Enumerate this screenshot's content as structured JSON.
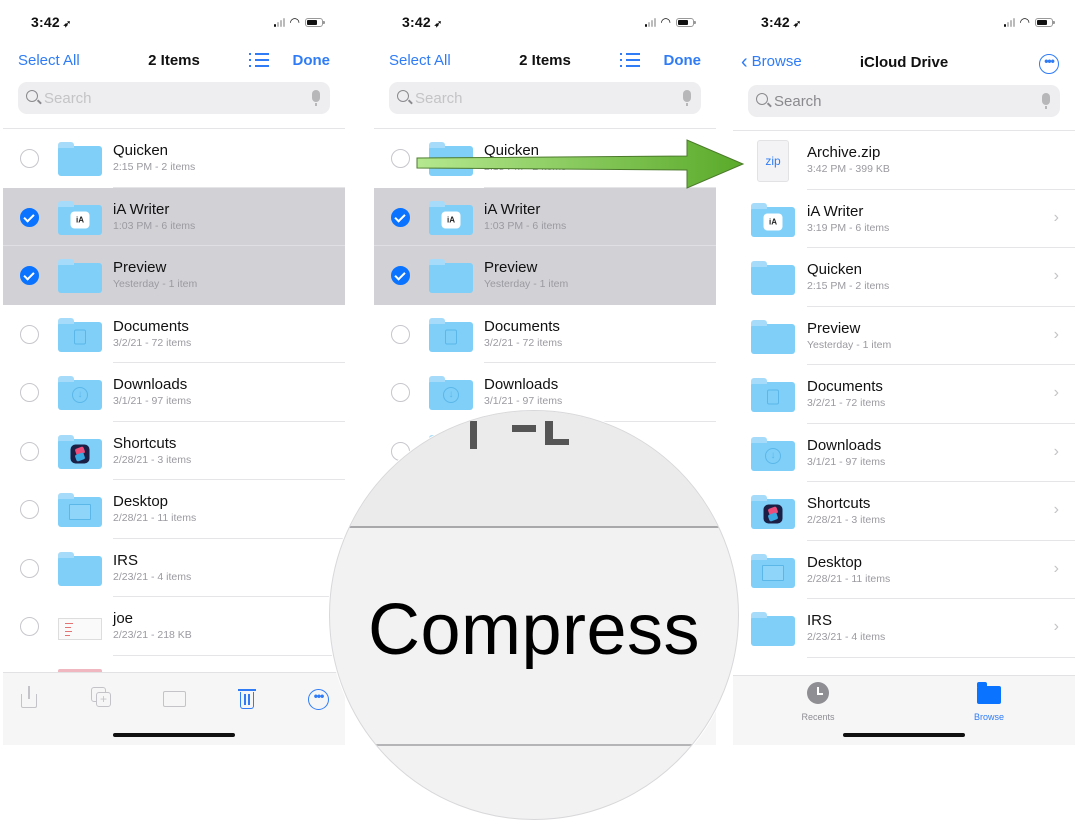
{
  "status_bar": {
    "time": "3:42",
    "location_icon": "location-arrow-icon"
  },
  "colors": {
    "accent": "#2f7cf6",
    "selection_bg": "#d1d1d6",
    "folder": "#7fcff8",
    "checkmark": "#0a73ff",
    "annotation_arrow": "#6cbf3a"
  },
  "screen1": {
    "nav": {
      "left": "Select All",
      "title": "2 Items",
      "right": "Done"
    },
    "search_placeholder": "Search",
    "items": [
      {
        "name": "Quicken",
        "detail": "2:15 PM - 2 items",
        "icon": "folder",
        "selected": false
      },
      {
        "name": "iA Writer",
        "detail": "1:03 PM - 6 items",
        "icon": "folder-ia",
        "selected": true
      },
      {
        "name": "Preview",
        "detail": "Yesterday - 1 item",
        "icon": "folder",
        "selected": true
      },
      {
        "name": "Documents",
        "detail": "3/2/21 - 72 items",
        "icon": "folder-doc",
        "selected": false
      },
      {
        "name": "Downloads",
        "detail": "3/1/21 - 97 items",
        "icon": "folder-download",
        "selected": false
      },
      {
        "name": "Shortcuts",
        "detail": "2/28/21 - 3 items",
        "icon": "folder-shortcuts",
        "selected": false
      },
      {
        "name": "Desktop",
        "detail": "2/28/21 - 11 items",
        "icon": "folder-desktop",
        "selected": false
      },
      {
        "name": "IRS",
        "detail": "2/23/21 - 4 items",
        "icon": "folder",
        "selected": false
      },
      {
        "name": "joe",
        "detail": "2/23/21 - 218 KB",
        "icon": "document-thumbnail",
        "selected": false
      }
    ],
    "toolbar": [
      "share-icon",
      "duplicate-icon",
      "move-folder-icon",
      "trash-icon",
      "more-icon"
    ]
  },
  "screen2": {
    "nav": {
      "left": "Select All",
      "title": "2 Items",
      "right": "Done"
    },
    "search_placeholder": "Search",
    "items": [
      {
        "name": "Quicken",
        "detail": "2:15 PM - 2 items",
        "selected": false
      },
      {
        "name": "iA Writer",
        "detail": "1:03 PM - 6 items",
        "selected": true
      },
      {
        "name": "Preview",
        "detail": "Yesterday - 1 item",
        "selected": true
      },
      {
        "name": "Documents",
        "detail": "3/2/21 - 72 items",
        "selected": false
      },
      {
        "name": "Downloads",
        "detail": "3/1/21 - 97 items",
        "selected": false
      }
    ],
    "magnifier_label": "Compress"
  },
  "screen3": {
    "nav": {
      "back": "Browse",
      "title": "iCloud Drive"
    },
    "search_placeholder": "Search",
    "items": [
      {
        "name": "Archive.zip",
        "detail": "3:42 PM - 399 KB",
        "icon": "zip-file",
        "badge": "zip"
      },
      {
        "name": "iA Writer",
        "detail": "3:19 PM - 6 items",
        "icon": "folder-ia"
      },
      {
        "name": "Quicken",
        "detail": "2:15 PM - 2 items",
        "icon": "folder"
      },
      {
        "name": "Preview",
        "detail": "Yesterday - 1 item",
        "icon": "folder"
      },
      {
        "name": "Documents",
        "detail": "3/2/21 - 72 items",
        "icon": "folder-doc"
      },
      {
        "name": "Downloads",
        "detail": "3/1/21 - 97 items",
        "icon": "folder-download"
      },
      {
        "name": "Shortcuts",
        "detail": "2/28/21 - 3 items",
        "icon": "folder-shortcuts"
      },
      {
        "name": "Desktop",
        "detail": "2/28/21 - 11 items",
        "icon": "folder-desktop"
      },
      {
        "name": "IRS",
        "detail": "2/23/21 - 4 items",
        "icon": "folder"
      }
    ],
    "tabs": [
      {
        "label": "Recents",
        "icon": "clock-icon",
        "active": false
      },
      {
        "label": "Browse",
        "icon": "folder-icon",
        "active": true
      }
    ]
  },
  "glyphs": {
    "ia": "iA",
    "down": "↓",
    "chevron": "›",
    "more": "•••",
    "back": "‹",
    "plus": "+",
    "wifi": "≋"
  }
}
